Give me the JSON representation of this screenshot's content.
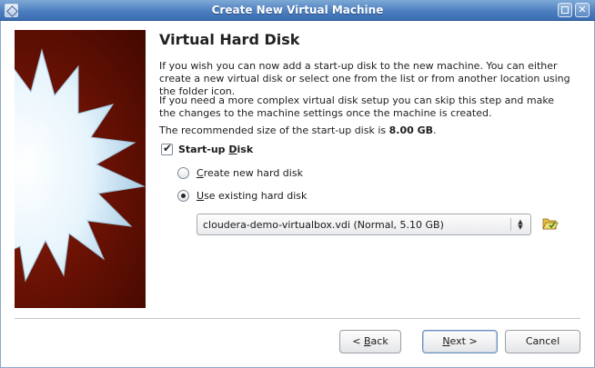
{
  "window": {
    "title": "Create New Virtual Machine",
    "buttons": [
      "maximize",
      "close"
    ]
  },
  "page": {
    "heading": "Virtual Hard Disk",
    "paragraph1": "If you wish you can now add a start-up disk to the new machine. You can either create a new virtual disk or select one from the list or from another location using the folder icon.",
    "paragraph2": "If you need a more complex virtual disk setup you can skip this step and make the changes to the machine settings once the machine is created.",
    "recommended_prefix": "The recommended size of the start-up disk is ",
    "recommended_size": "8.00 GB",
    "recommended_suffix": "."
  },
  "startup_disk": {
    "label_prefix": "Start-up ",
    "label_mnemonic": "D",
    "label_suffix": "isk",
    "checked": true
  },
  "options": {
    "create_new": {
      "mnemonic": "C",
      "rest": "reate new hard disk",
      "selected": false
    },
    "use_existing": {
      "mnemonic": "U",
      "rest": "se existing hard disk",
      "selected": true
    }
  },
  "disk_select": {
    "value": "cloudera-demo-virtualbox.vdi (Normal, 5.10 GB)"
  },
  "icons": {
    "folder": "folder-open-icon",
    "app": "virtualbox-icon"
  },
  "buttons": {
    "back_prefix": "< ",
    "back_mnemonic": "B",
    "back_rest": "ack",
    "next_mnemonic": "N",
    "next_rest": "ext >",
    "cancel": "Cancel"
  },
  "colors": {
    "titlebar": "#4d7fc0",
    "wizard_bg": "#6b1204",
    "star": "#dff0fb"
  }
}
